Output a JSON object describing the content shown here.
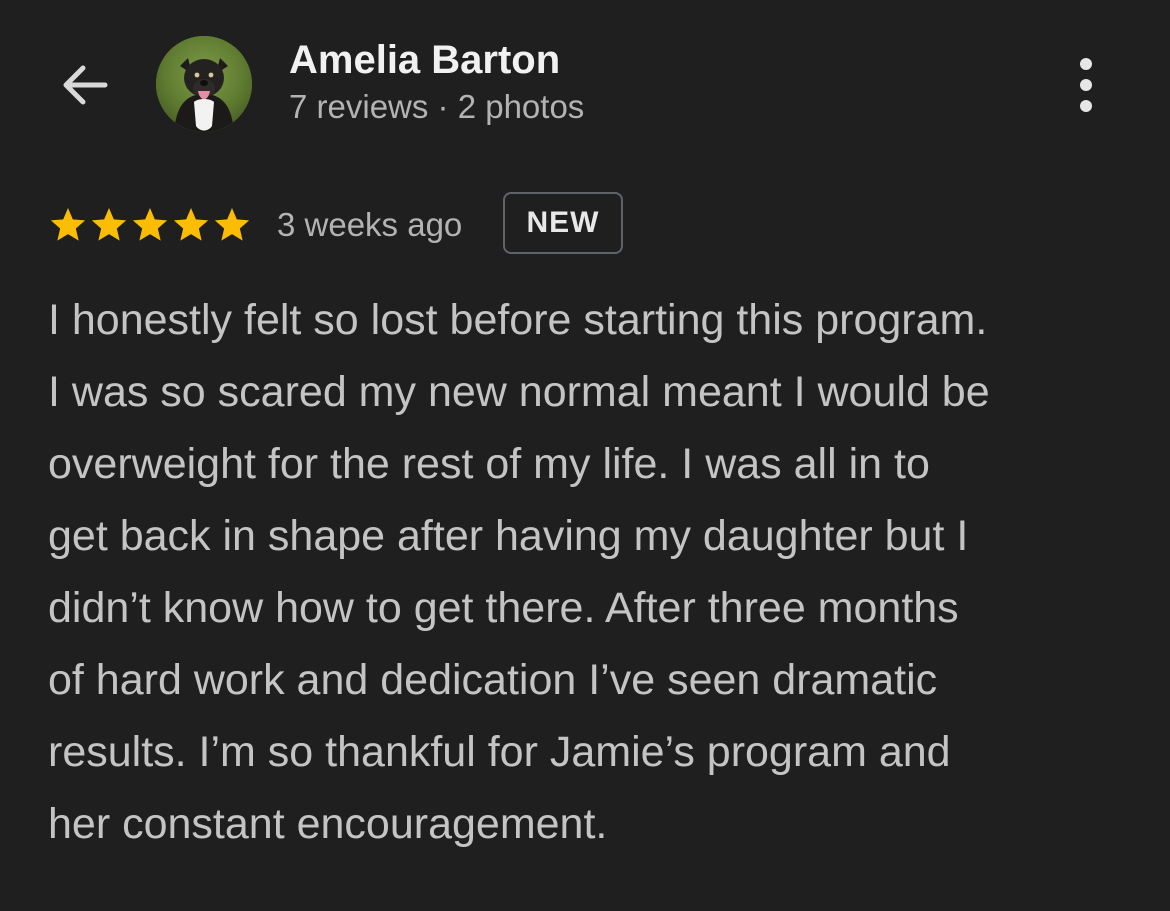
{
  "header": {
    "back_icon": "arrow-back-icon",
    "user_name": "Amelia Barton",
    "user_meta": "7 reviews · 2 photos",
    "more_icon": "more-vert-icon"
  },
  "review": {
    "rating": 5,
    "rating_max": 5,
    "star_color": "#fbbc04",
    "time_ago": "3 weeks ago",
    "badge": "NEW",
    "lines": [
      "I honestly felt so lost before starting this program.",
      "I was so scared my new normal meant I would be",
      "overweight for the rest of my life. I was all in to",
      "get back in shape after having my daughter but I",
      "didn’t know how to get there. After three months",
      "of hard work and dedication I’ve seen dramatic",
      "results. I’m so thankful for Jamie’s program and",
      "her constant encouragement."
    ]
  },
  "colors": {
    "background": "#1f1f1f",
    "name": "#f1f1f1",
    "secondary_text": "#b3b3b3",
    "body_text": "#c4c4c4"
  }
}
